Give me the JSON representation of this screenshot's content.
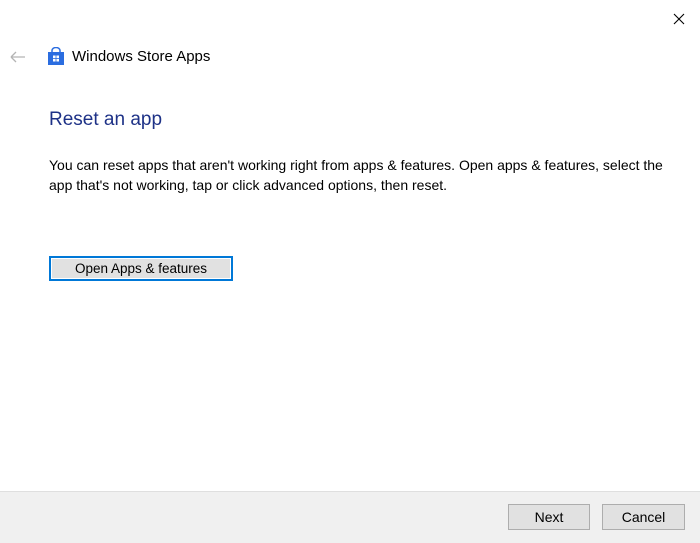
{
  "window": {
    "title": "Windows Store Apps"
  },
  "icons": {
    "close": "close-icon",
    "back": "back-arrow-icon",
    "app": "store-bag-icon"
  },
  "main": {
    "heading": "Reset an app",
    "description": "You can reset apps that aren't working right from apps & features. Open apps & features, select the app that's not working, tap or click advanced options, then reset.",
    "open_button": "Open Apps & features"
  },
  "footer": {
    "next": "Next",
    "cancel": "Cancel"
  },
  "colors": {
    "accent": "#0078d7",
    "heading": "#1e3287"
  }
}
